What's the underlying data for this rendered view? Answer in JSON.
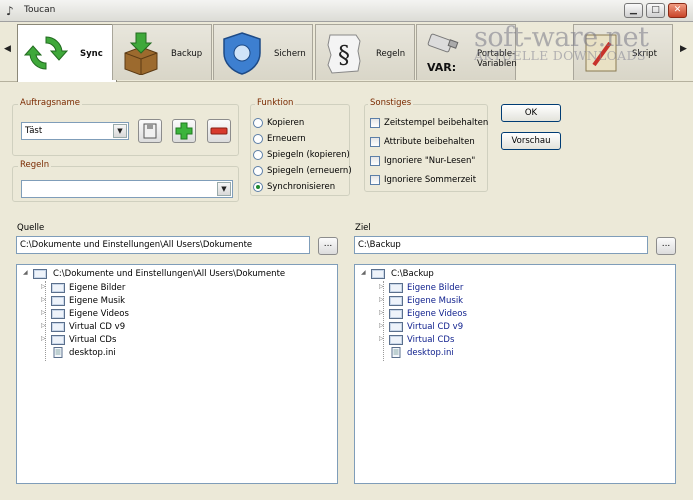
{
  "window": {
    "title": "Toucan"
  },
  "toolbar": {
    "tabs": [
      {
        "label": "Sync",
        "icon": "sync-arrows-icon",
        "active": true
      },
      {
        "label": "Backup",
        "icon": "box-download-icon",
        "active": false
      },
      {
        "label": "Sichern",
        "icon": "shield-icon",
        "active": false
      },
      {
        "label": "Regeln",
        "icon": "paragraph-document-icon",
        "active": false
      },
      {
        "label": "Portable-Variablen",
        "icon": "usb-var-icon",
        "active": false
      },
      {
        "label": "Skript",
        "icon": "script-icon",
        "active": false
      }
    ]
  },
  "watermark": {
    "line1": "soft-ware.net",
    "line2": "AKTUELLE DOWNLOADS"
  },
  "auftrag": {
    "title": "Auftragsname",
    "value": "Täst"
  },
  "regeln": {
    "title": "Regeln",
    "value": ""
  },
  "funktion": {
    "title": "Funktion",
    "options": [
      "Kopieren",
      "Erneuern",
      "Spiegeln (kopieren)",
      "Spiegeln (erneuern)",
      "Synchronisieren"
    ],
    "selected": "Synchronisieren"
  },
  "sonstiges": {
    "title": "Sonstiges",
    "options": [
      "Zeitstempel beibehalten",
      "Attribute beibehalten",
      "Ignoriere \"Nur-Lesen\"",
      "Ignoriere Sommerzeit"
    ]
  },
  "buttons": {
    "ok": "OK",
    "preview": "Vorschau",
    "browse": "..."
  },
  "quelle": {
    "label": "Quelle",
    "path": "C:\\Dokumente und Einstellungen\\All Users\\Dokumente",
    "tree": {
      "root": "C:\\Dokumente und Einstellungen\\All Users\\Dokumente",
      "children": [
        "Eigene Bilder",
        "Eigene Musik",
        "Eigene Videos",
        "Virtual CD v9",
        "Virtual CDs",
        "desktop.ini"
      ]
    }
  },
  "ziel": {
    "label": "Ziel",
    "path": "C:\\Backup",
    "tree": {
      "root": "C:\\Backup",
      "children": [
        "Eigene Bilder",
        "Eigene Musik",
        "Eigene Videos",
        "Virtual CD v9",
        "Virtual CDs",
        "desktop.ini"
      ]
    }
  }
}
